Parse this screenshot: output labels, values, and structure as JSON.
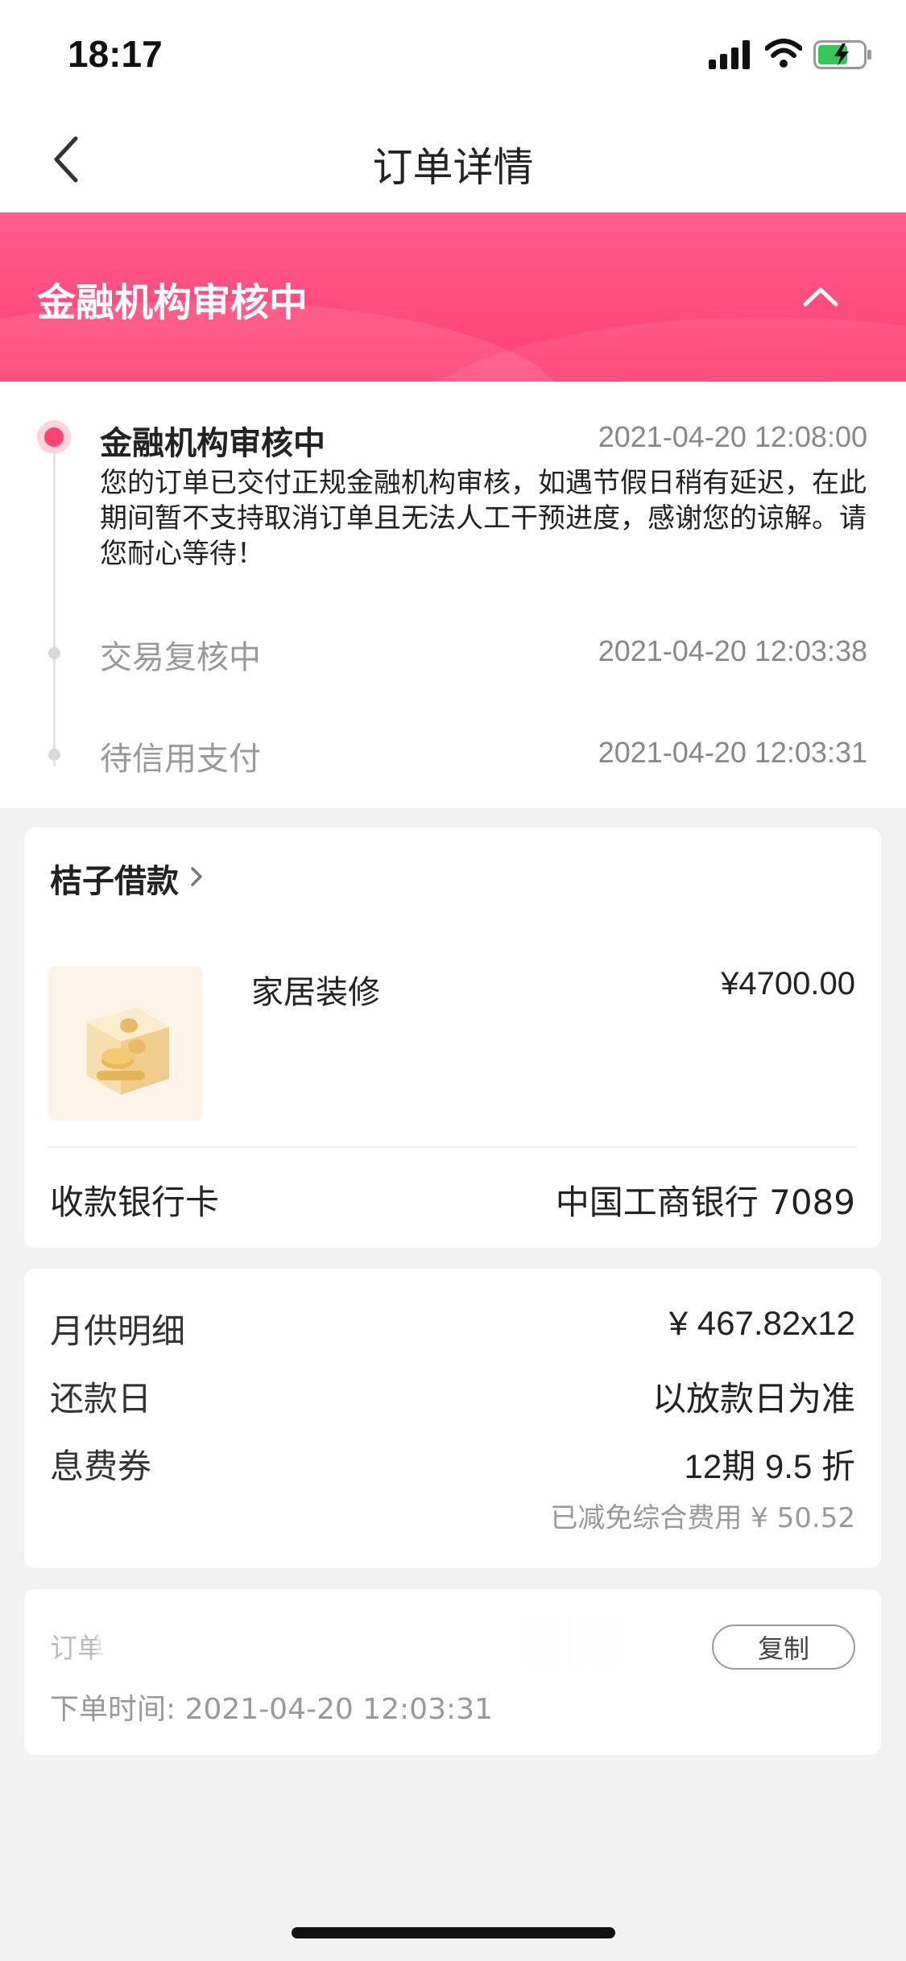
{
  "status_bar": {
    "time": "18:17"
  },
  "nav": {
    "title": "订单详情"
  },
  "banner": {
    "title": "金融机构审核中"
  },
  "timeline": [
    {
      "title": "金融机构审核中",
      "time": "2021-04-20 12:08:00",
      "desc": "您的订单已交付正规金融机构审核，如遇节假日稍有延迟，在此期间暂不支持取消订单且无法人工干预进度，感谢您的谅解。请您耐心等待！"
    },
    {
      "title": "交易复核中",
      "time": "2021-04-20 12:03:38"
    },
    {
      "title": "待信用支付",
      "time": "2021-04-20 12:03:31"
    }
  ],
  "product_card": {
    "merchant": "桔子借款",
    "product_name": "家居装修",
    "price": "¥4700.00",
    "bank_label": "收款银行卡",
    "bank_value": "中国工商银行 7089"
  },
  "repayment_card": {
    "monthly_label": "月供明细",
    "monthly_value": "¥ 467.82x12",
    "due_label": "还款日",
    "due_value": "以放款日为准",
    "coupon_label": "息费券",
    "coupon_value": "12期 9.5 折",
    "coupon_note": "已减免综合费用 ¥ 50.52"
  },
  "order_card": {
    "order_no_label": "订单",
    "copy_label": "复制",
    "order_time": "下单时间: 2021-04-20 12:03:31"
  },
  "colors": {
    "accent": "#ff4474",
    "banner_from": "#ff5d8c",
    "banner_to": "#ff3f74"
  }
}
